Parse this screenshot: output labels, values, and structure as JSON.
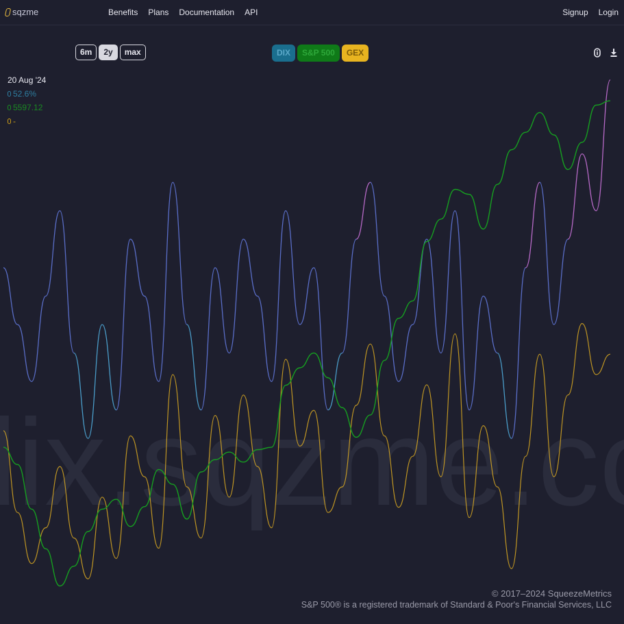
{
  "nav": {
    "logo_text": "sqzme",
    "links": [
      "Benefits",
      "Plans",
      "Documentation",
      "API"
    ],
    "signup": "Signup",
    "login": "Login"
  },
  "range_buttons": [
    "6m",
    "2y",
    "max"
  ],
  "active_range": "2y",
  "series_buttons": [
    "DIX",
    "S&P 500",
    "GEX"
  ],
  "readout": {
    "date": "20 Aug '24",
    "dix": "52.6%",
    "spx": "5597.12",
    "gex": "-"
  },
  "watermark": "dix.sqzme.co",
  "footer": {
    "copyright": "© 2017–2024 SqueezeMetrics",
    "trademark": "S&P 500® is a registered trademark of Standard & Poor's Financial Services, LLC"
  },
  "colors": {
    "background": "#1e1f2e",
    "dix": "#4a9cc8",
    "spx": "#16a020",
    "gex": "#e8b420",
    "dix_high": "#b86ac8",
    "dix_low": "#5a6ec8"
  },
  "icons": {
    "info": "info-icon",
    "download": "download-icon"
  },
  "chart_data": {
    "type": "line",
    "x_range": [
      "2022-08-22",
      "2024-08-20"
    ],
    "series": [
      {
        "name": "S&P 500",
        "values": [
          4200,
          4130,
          3950,
          3790,
          3640,
          3720,
          3860,
          3950,
          3990,
          3880,
          3960,
          4110,
          4050,
          3910,
          4100,
          4150,
          4180,
          4140,
          4190,
          4200,
          4450,
          4520,
          4580,
          4480,
          4360,
          4240,
          4330,
          4550,
          4720,
          4790,
          5030,
          5120,
          5240,
          5220,
          5080,
          5260,
          5400,
          5470,
          5550,
          5460,
          5320,
          5430,
          5580,
          5597.12
        ]
      },
      {
        "name": "DIX",
        "values": [
          46,
          44,
          42,
          45,
          48,
          43,
          40,
          44,
          41,
          47,
          45,
          42,
          49,
          44,
          41,
          46,
          43,
          47,
          45,
          42,
          48,
          44,
          46,
          41,
          43,
          47,
          49,
          45,
          42,
          44,
          47,
          43,
          48,
          41,
          45,
          43,
          40,
          46,
          49,
          44,
          47,
          50,
          48,
          52.6
        ]
      },
      {
        "name": "GEX",
        "values": [
          3.1,
          1.5,
          0.5,
          1.2,
          2.4,
          1.0,
          0.2,
          1.8,
          0.6,
          3.0,
          2.2,
          0.8,
          4.2,
          2.0,
          1.0,
          3.4,
          1.8,
          3.8,
          2.4,
          1.2,
          4.5,
          2.8,
          3.5,
          1.5,
          2.0,
          3.6,
          4.8,
          3.0,
          1.6,
          2.6,
          4.0,
          2.2,
          5.0,
          1.4,
          3.2,
          2.0,
          0.4,
          2.6,
          4.6,
          2.2,
          3.8,
          5.2,
          4.2,
          4.6
        ]
      }
    ]
  }
}
